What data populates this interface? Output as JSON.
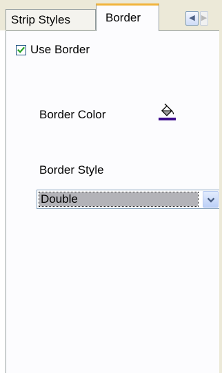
{
  "tabs": [
    {
      "label": "Strip Styles",
      "selected": false
    },
    {
      "label": "Border",
      "selected": true
    }
  ],
  "tab_scroll": {
    "left_icon": "arrow-left-icon",
    "right_icon": "arrow-right-icon"
  },
  "use_border": {
    "label": "Use Border",
    "checked": true
  },
  "border_color": {
    "label": "Border Color",
    "icon": "paint-bucket-icon",
    "value": "#3b0a8c"
  },
  "border_style": {
    "label": "Border Style",
    "selected_value": "Double",
    "dropdown_icon": "chevron-down-icon"
  },
  "colors": {
    "tab_accent": "#f1b33a",
    "panel_background": "#fcfcfe",
    "chrome_background": "#ece9d8"
  }
}
